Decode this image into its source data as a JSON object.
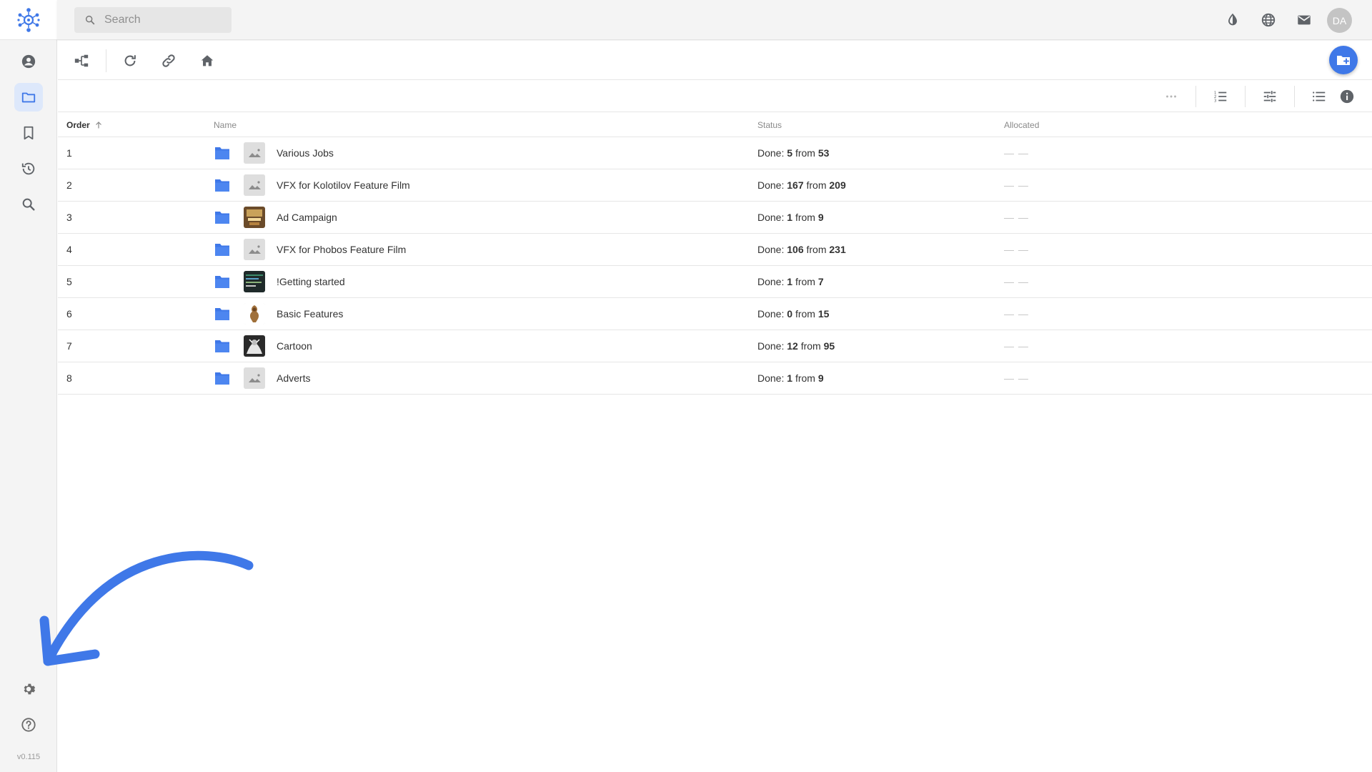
{
  "search": {
    "placeholder": "Search"
  },
  "user": {
    "initials": "DA"
  },
  "app": {
    "version": "v0.115"
  },
  "colors": {
    "accent": "#3f78e8",
    "folder": "#3f78e8",
    "rail_active": "#dde8fb"
  },
  "sidebar": {
    "items": [
      {
        "icon": "user-icon",
        "active": false
      },
      {
        "icon": "folder-icon",
        "active": true
      },
      {
        "icon": "bookmark-icon",
        "active": false
      },
      {
        "icon": "history-icon",
        "active": false
      },
      {
        "icon": "search-icon",
        "active": false
      }
    ],
    "bottom": [
      {
        "icon": "gear-icon"
      },
      {
        "icon": "help-icon"
      }
    ]
  },
  "table": {
    "columns": {
      "order": "Order",
      "name": "Name",
      "status": "Status",
      "allocated": "Allocated"
    },
    "status_prefix": "Done:",
    "status_from": "from",
    "empty_value": "— —",
    "rows": [
      {
        "order": "1",
        "name": "Various Jobs",
        "done": "5",
        "total": "53",
        "thumb": "placeholder"
      },
      {
        "order": "2",
        "name": "VFX for Kolotilov Feature Film",
        "done": "167",
        "total": "209",
        "thumb": "placeholder"
      },
      {
        "order": "3",
        "name": "Ad Campaign",
        "done": "1",
        "total": "9",
        "thumb": "image-ad"
      },
      {
        "order": "4",
        "name": "VFX for Phobos Feature Film",
        "done": "106",
        "total": "231",
        "thumb": "placeholder"
      },
      {
        "order": "5",
        "name": "!Getting started",
        "done": "1",
        "total": "7",
        "thumb": "image-dark"
      },
      {
        "order": "6",
        "name": "Basic Features",
        "done": "0",
        "total": "15",
        "thumb": "image-figure"
      },
      {
        "order": "7",
        "name": "Cartoon",
        "done": "12",
        "total": "95",
        "thumb": "image-bw"
      },
      {
        "order": "8",
        "name": "Adverts",
        "done": "1",
        "total": "9",
        "thumb": "placeholder"
      }
    ]
  }
}
